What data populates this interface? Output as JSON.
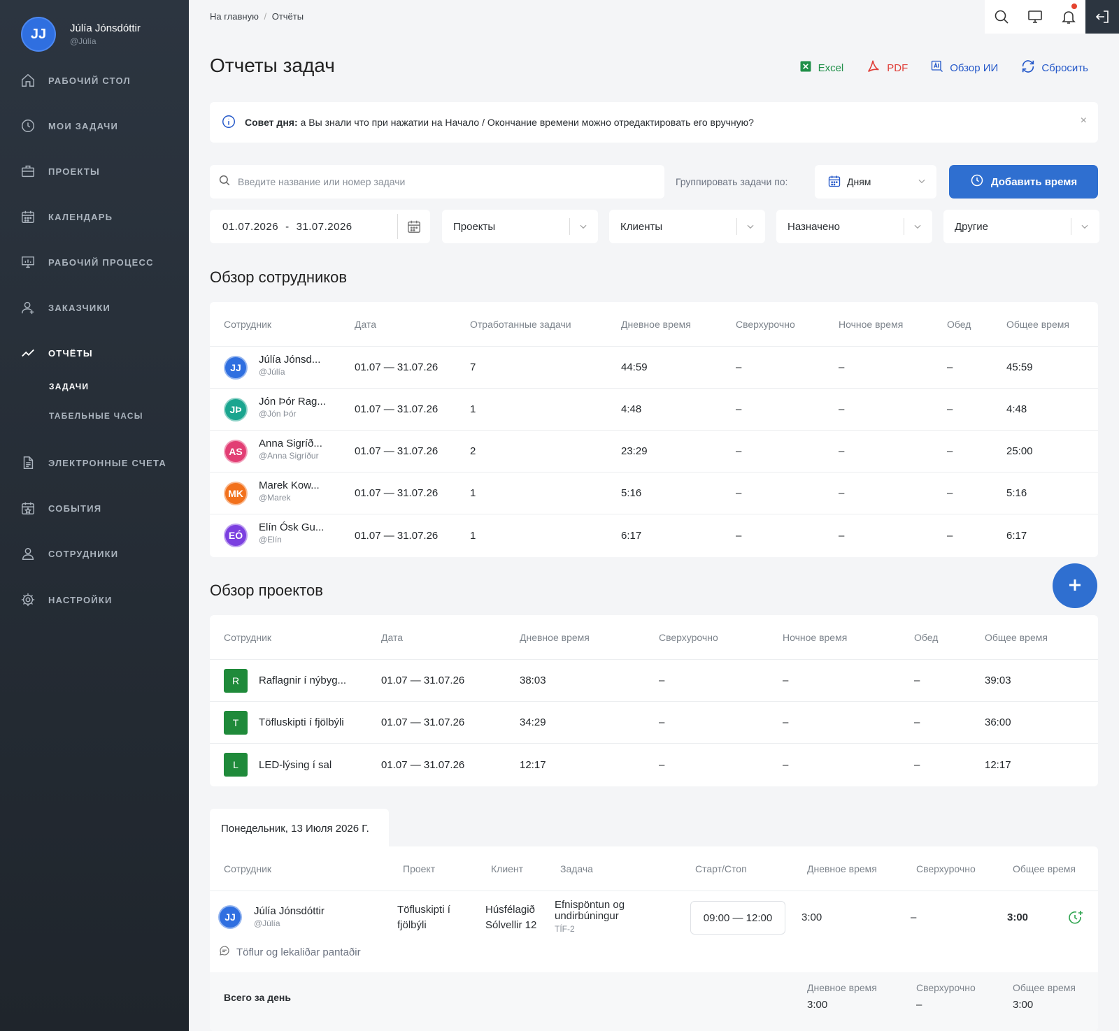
{
  "user": {
    "initials": "JJ",
    "name": "Júlía Jónsdóttir",
    "handle": "@Júlía"
  },
  "nav": [
    {
      "label": "РАБОЧИЙ СТОЛ",
      "icon": "home-icon"
    },
    {
      "label": "МОИ ЗАДАЧИ",
      "icon": "clock-icon"
    },
    {
      "label": "ПРОЕКТЫ",
      "icon": "briefcase-icon"
    },
    {
      "label": "КАЛЕНДАРЬ",
      "icon": "calendar-icon"
    },
    {
      "label": "РАБОЧИЙ ПРОЦЕСС",
      "icon": "presentation-icon"
    },
    {
      "label": "ЗАКАЗЧИКИ",
      "icon": "user-icon"
    },
    {
      "label": "ОТЧЁТЫ",
      "icon": "trend-icon"
    },
    {
      "label": "ЭЛЕКТРОННЫЕ СЧЕТА",
      "icon": "document-icon"
    },
    {
      "label": "СОБЫТИЯ",
      "icon": "calendar-star-icon"
    },
    {
      "label": "СОТРУДНИКИ",
      "icon": "users-icon"
    },
    {
      "label": "НАСТРОЙКИ",
      "icon": "gear-icon"
    }
  ],
  "subnav": [
    "ЗАДАЧИ",
    "ТАБЕЛЬНЫЕ ЧАСЫ"
  ],
  "breadcrumb": {
    "home": "На главную",
    "sep": "/",
    "current": "Отчёты"
  },
  "page_title": "Отчеты задач",
  "actions": {
    "excel": "Excel",
    "pdf": "PDF",
    "ai": "Обзор ИИ",
    "reset": "Сбросить"
  },
  "tip": {
    "bold": "Совет дня:",
    "text": "а Вы знали что при нажатии на Начало / Окончание времени можно отредактировать его вручную?",
    "close": "×"
  },
  "search": {
    "placeholder": "Введите название или номер задачи"
  },
  "group": {
    "label": "Группировать задачи по:",
    "value": "Дням"
  },
  "add_time": "Добавить время",
  "date_range": {
    "from": "01.07.2026",
    "sep": "-",
    "to": "31.07.2026"
  },
  "filters": [
    "Проекты",
    "Клиенты",
    "Назначено",
    "Другие"
  ],
  "employees": {
    "title": "Обзор сотрудников",
    "headers": [
      "Сотрудник",
      "Дата",
      "Отработанные задачи",
      "Дневное время",
      "Сверхурочно",
      "Ночное время",
      "Обед",
      "Общее время"
    ],
    "rows": [
      {
        "initials": "JJ",
        "color": "#2f6fe0",
        "name": "Júlía Jónsd...",
        "handle": "@Júlía",
        "date": "01.07 — 31.07.26",
        "tasks": "7",
        "day": "44:59",
        "over": "–",
        "night": "–",
        "lunch": "–",
        "total": "45:59"
      },
      {
        "initials": "JÞ",
        "color": "#1aa58f",
        "name": "Jón Þór Rag...",
        "handle": "@Jón Þór",
        "date": "01.07 — 31.07.26",
        "tasks": "1",
        "day": "4:48",
        "over": "–",
        "night": "–",
        "lunch": "–",
        "total": "4:48"
      },
      {
        "initials": "AS",
        "color": "#e23e74",
        "name": "Anna Sigríð...",
        "handle": "@Anna Sigríður",
        "date": "01.07 — 31.07.26",
        "tasks": "2",
        "day": "23:29",
        "over": "–",
        "night": "–",
        "lunch": "–",
        "total": "25:00"
      },
      {
        "initials": "MK",
        "color": "#f2711c",
        "name": "Marek Kow...",
        "handle": "@Marek",
        "date": "01.07 — 31.07.26",
        "tasks": "1",
        "day": "5:16",
        "over": "–",
        "night": "–",
        "lunch": "–",
        "total": "5:16"
      },
      {
        "initials": "EÓ",
        "color": "#7b3fe0",
        "name": "Elín Ósk Gu...",
        "handle": "@Elín",
        "date": "01.07 — 31.07.26",
        "tasks": "1",
        "day": "6:17",
        "over": "–",
        "night": "–",
        "lunch": "–",
        "total": "6:17"
      }
    ]
  },
  "projects": {
    "title": "Обзор проектов",
    "headers": [
      "Сотрудник",
      "Дата",
      "Дневное время",
      "Сверхурочно",
      "Ночное время",
      "Обед",
      "Общее время"
    ],
    "rows": [
      {
        "letter": "R",
        "name": "Raflagnir í nýbyg...",
        "date": "01.07 — 31.07.26",
        "day": "38:03",
        "over": "–",
        "night": "–",
        "lunch": "–",
        "total": "39:03"
      },
      {
        "letter": "T",
        "name": "Töfluskipti í fjölbýli",
        "date": "01.07 — 31.07.26",
        "day": "34:29",
        "over": "–",
        "night": "–",
        "lunch": "–",
        "total": "36:00"
      },
      {
        "letter": "L",
        "name": "LED-lýsing í sal",
        "date": "01.07 — 31.07.26",
        "day": "12:17",
        "over": "–",
        "night": "–",
        "lunch": "–",
        "total": "12:17"
      }
    ]
  },
  "day": {
    "tab": "Понедельник, 13 Июля 2026 Г.",
    "headers": [
      "Сотрудник",
      "Проект",
      "Клиент",
      "Задача",
      "Старт/Стоп",
      "Дневное время",
      "Сверхурочно",
      "Общее время"
    ],
    "entry": {
      "initials": "JJ",
      "name": "Júlía Jónsdóttir",
      "handle": "@Júlía",
      "project_l1": "Töfluskipti í",
      "project_l2": "fjölbýli",
      "client_l1": "Húsfélagið",
      "client_l2": "Sólvellir 12",
      "task_l1": "Efnispöntun og",
      "task_l2": "undirbúningur",
      "task_code": "TÍF-2",
      "time": "09:00 — 12:00",
      "day": "3:00",
      "over": "–",
      "total": "3:00",
      "comment": "Töflur og lekaliðar pantaðir"
    },
    "total": {
      "label": "Всего за день",
      "day_label": "Дневное время",
      "day": "3:00",
      "over_label": "Сверхурочно",
      "over": "–",
      "total_label": "Общее время",
      "total": "3:00"
    }
  }
}
